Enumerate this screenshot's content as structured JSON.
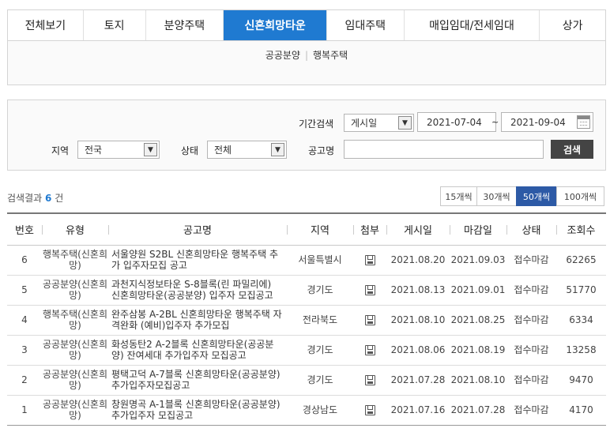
{
  "tabs": [
    {
      "label": "전체보기"
    },
    {
      "label": "토지"
    },
    {
      "label": "분양주택"
    },
    {
      "label": "신혼희망타운",
      "active": true
    },
    {
      "label": "임대주택"
    },
    {
      "label": "매입임대/전세임대"
    },
    {
      "label": "상가"
    }
  ],
  "subtabs": [
    "공공분양",
    "행복주택"
  ],
  "search": {
    "period_label": "기간검색",
    "period_type": "게시일",
    "date_from": "2021-07-04",
    "date_sep": "~",
    "date_to": "2021-09-04",
    "region_label": "지역",
    "region_value": "전국",
    "status_label": "상태",
    "status_value": "전체",
    "title_label": "공고명",
    "title_value": "",
    "search_button": "검색"
  },
  "results": {
    "prefix": "검색결과",
    "count": "6",
    "suffix": "건"
  },
  "page_size_options": [
    {
      "label": "15개씩"
    },
    {
      "label": "30개씩"
    },
    {
      "label": "50개씩",
      "active": true
    },
    {
      "label": "100개씩"
    }
  ],
  "table": {
    "columns": [
      "번호",
      "유형",
      "공고명",
      "지역",
      "첨부",
      "게시일",
      "마감일",
      "상태",
      "조회수"
    ],
    "rows": [
      {
        "no": "6",
        "type": "행복주택(신혼희망)",
        "title": "서울양원 S2BL 신혼희망타운 행복주택 추가 입주자모집 공고",
        "region": "서울특별시",
        "attach": "file-icon",
        "posted": "2021.08.20",
        "deadline": "2021.09.03",
        "status": "접수마감",
        "views": "62265"
      },
      {
        "no": "5",
        "type": "공공분양(신혼희망)",
        "title": "과천지식정보타운 S-8블록(린 파밀리에) 신혼희망타운(공공분양) 입주자 모집공고",
        "region": "경기도",
        "attach": "file-icon",
        "posted": "2021.08.13",
        "deadline": "2021.09.01",
        "status": "접수마감",
        "views": "51770"
      },
      {
        "no": "4",
        "type": "행복주택(신혼희망)",
        "title": "완주삼봉 A-2BL 신혼희망타운 행복주택 자격완화 (예비)입주자 추가모집",
        "region": "전라북도",
        "attach": "file-icon",
        "posted": "2021.08.10",
        "deadline": "2021.08.25",
        "status": "접수마감",
        "views": "6334"
      },
      {
        "no": "3",
        "type": "공공분양(신혼희망)",
        "title": "화성동탄2 A-2블록 신혼희망타운(공공분양) 잔여세대 추가입주자 모집공고",
        "region": "경기도",
        "attach": "file-icon",
        "posted": "2021.08.06",
        "deadline": "2021.08.19",
        "status": "접수마감",
        "views": "13258"
      },
      {
        "no": "2",
        "type": "공공분양(신혼희망)",
        "title": "평택고덕 A-7블록 신혼희망타운(공공분양) 추가입주자모집공고",
        "region": "경기도",
        "attach": "file-icon",
        "posted": "2021.07.28",
        "deadline": "2021.08.10",
        "status": "접수마감",
        "views": "9470"
      },
      {
        "no": "1",
        "type": "공공분양(신혼희망)",
        "title": "창원명곡 A-1블록 신혼희망타운(공공분양) 추가입주자 모집공고",
        "region": "경상남도",
        "attach": "file-icon",
        "posted": "2021.07.16",
        "deadline": "2021.07.28",
        "status": "접수마감",
        "views": "4170"
      }
    ]
  },
  "colors": {
    "accent": "#1f7ad1",
    "page_size_active": "#2d5aa6",
    "search_button": "#444444"
  }
}
